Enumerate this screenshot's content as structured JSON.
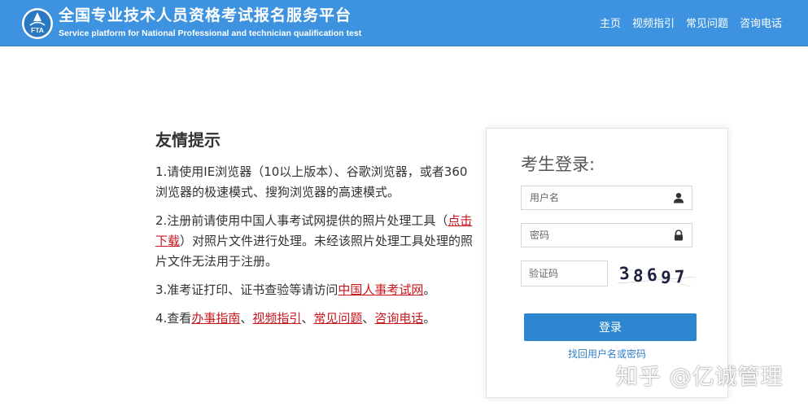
{
  "header": {
    "logo_text": "FTA",
    "title": "全国专业技术人员资格考试报名服务平台",
    "subtitle": "Service platform for National Professional and technician qualification test",
    "nav": [
      {
        "label": "主页"
      },
      {
        "label": "视频指引"
      },
      {
        "label": "常见问题"
      },
      {
        "label": "咨询电话"
      }
    ]
  },
  "tips": {
    "title": "友情提示",
    "tip1": "1.请使用IE浏览器（10以上版本）、谷歌浏览器，或者360浏览器的极速模式、搜狗浏览器的高速模式。",
    "tip2": {
      "before": "2.注册前请使用中国人事考试网提供的照片处理工具（",
      "link": "点击下载",
      "after": "）对照片文件进行处理。未经该照片处理工具处理的照片文件无法用于注册。"
    },
    "tip3": {
      "before": "3.准考证打印、证书查验等请访问",
      "link": "中国人事考试网",
      "after": "。"
    },
    "tip4": {
      "before": "4.查看",
      "links": [
        "办事指南",
        "视频指引",
        "常见问题",
        "咨询电话"
      ],
      "separator": "、",
      "after": "。"
    }
  },
  "login": {
    "title": "考生登录:",
    "username_placeholder": "用户名",
    "username_icon": "user-icon",
    "password_placeholder": "密码",
    "password_icon": "lock-icon",
    "captcha_placeholder": "验证码",
    "captcha_chars": [
      "3",
      "8",
      "6",
      "9",
      "7"
    ],
    "login_label": "登录",
    "recover_label": "找回用户名或密码"
  },
  "watermark": "知乎 @亿诚管理",
  "colors": {
    "header_bg": "#3d93df",
    "button_bg": "#2d87d0",
    "link_red": "#c8161d",
    "link_blue": "#2f7fc6"
  }
}
